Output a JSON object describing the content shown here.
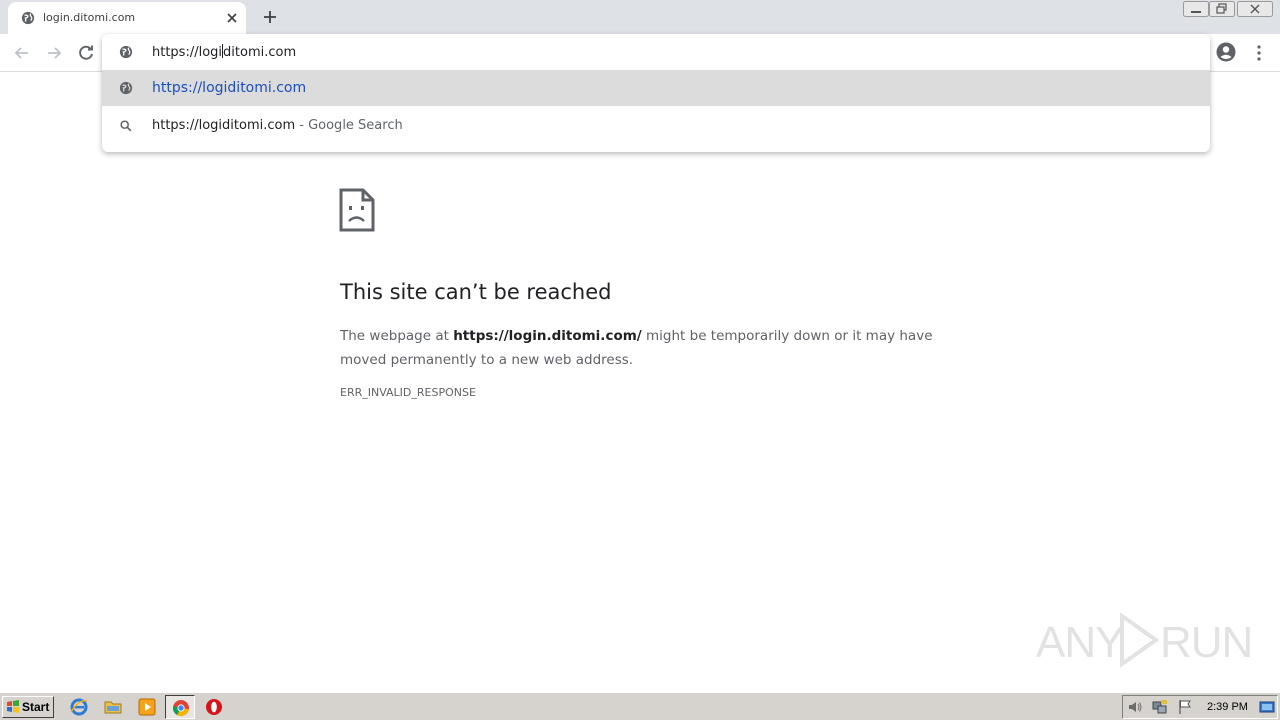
{
  "browser": {
    "tab": {
      "title": "login.ditomi.com",
      "favicon": "globe-icon",
      "close_icon": "close-icon"
    },
    "new_tab_icon": "plus-icon",
    "window_controls": [
      "minimize-icon",
      "maximize-icon",
      "close-icon"
    ],
    "toolbar": {
      "back_icon": "arrow-left-icon",
      "forward_icon": "arrow-right-icon",
      "reload_icon": "reload-icon",
      "profile_icon": "account-circle-icon",
      "menu_icon": "more-vertical-icon"
    },
    "omnibox": {
      "value_before_caret": "https://logi",
      "value_after_caret": "ditomi.com",
      "suggestions": [
        {
          "icon": "globe-icon",
          "url": "https://logiditomi.com",
          "selected": true
        },
        {
          "icon": "search-icon",
          "text": "https://logiditomi.com",
          "suffix": " - Google Search",
          "selected": false
        }
      ]
    }
  },
  "error_page": {
    "icon": "sad-page-icon",
    "title": "This site can’t be reached",
    "body_prefix": "The webpage at ",
    "body_url": "https://login.ditomi.com/",
    "body_suffix": " might be temporarily down or it may have moved permanently to a new web address.",
    "code": "ERR_INVALID_RESPONSE"
  },
  "watermark": {
    "left": "ANY",
    "right": "RUN"
  },
  "taskbar": {
    "start_label": "Start",
    "quick_launch": [
      "internet-explorer-icon",
      "folder-icon",
      "media-player-icon",
      "chrome-icon",
      "opera-icon"
    ],
    "tray": {
      "icons": [
        "volume-icon",
        "network-icon",
        "flag-icon",
        "show-desktop-icon"
      ],
      "clock": "2:39 PM"
    }
  },
  "colors": {
    "tabstrip": "#dee1e6",
    "suggestion_selected": "#dcdcdc",
    "link_blue": "#1a4ebd",
    "taskbar": "#d6d3ce"
  }
}
